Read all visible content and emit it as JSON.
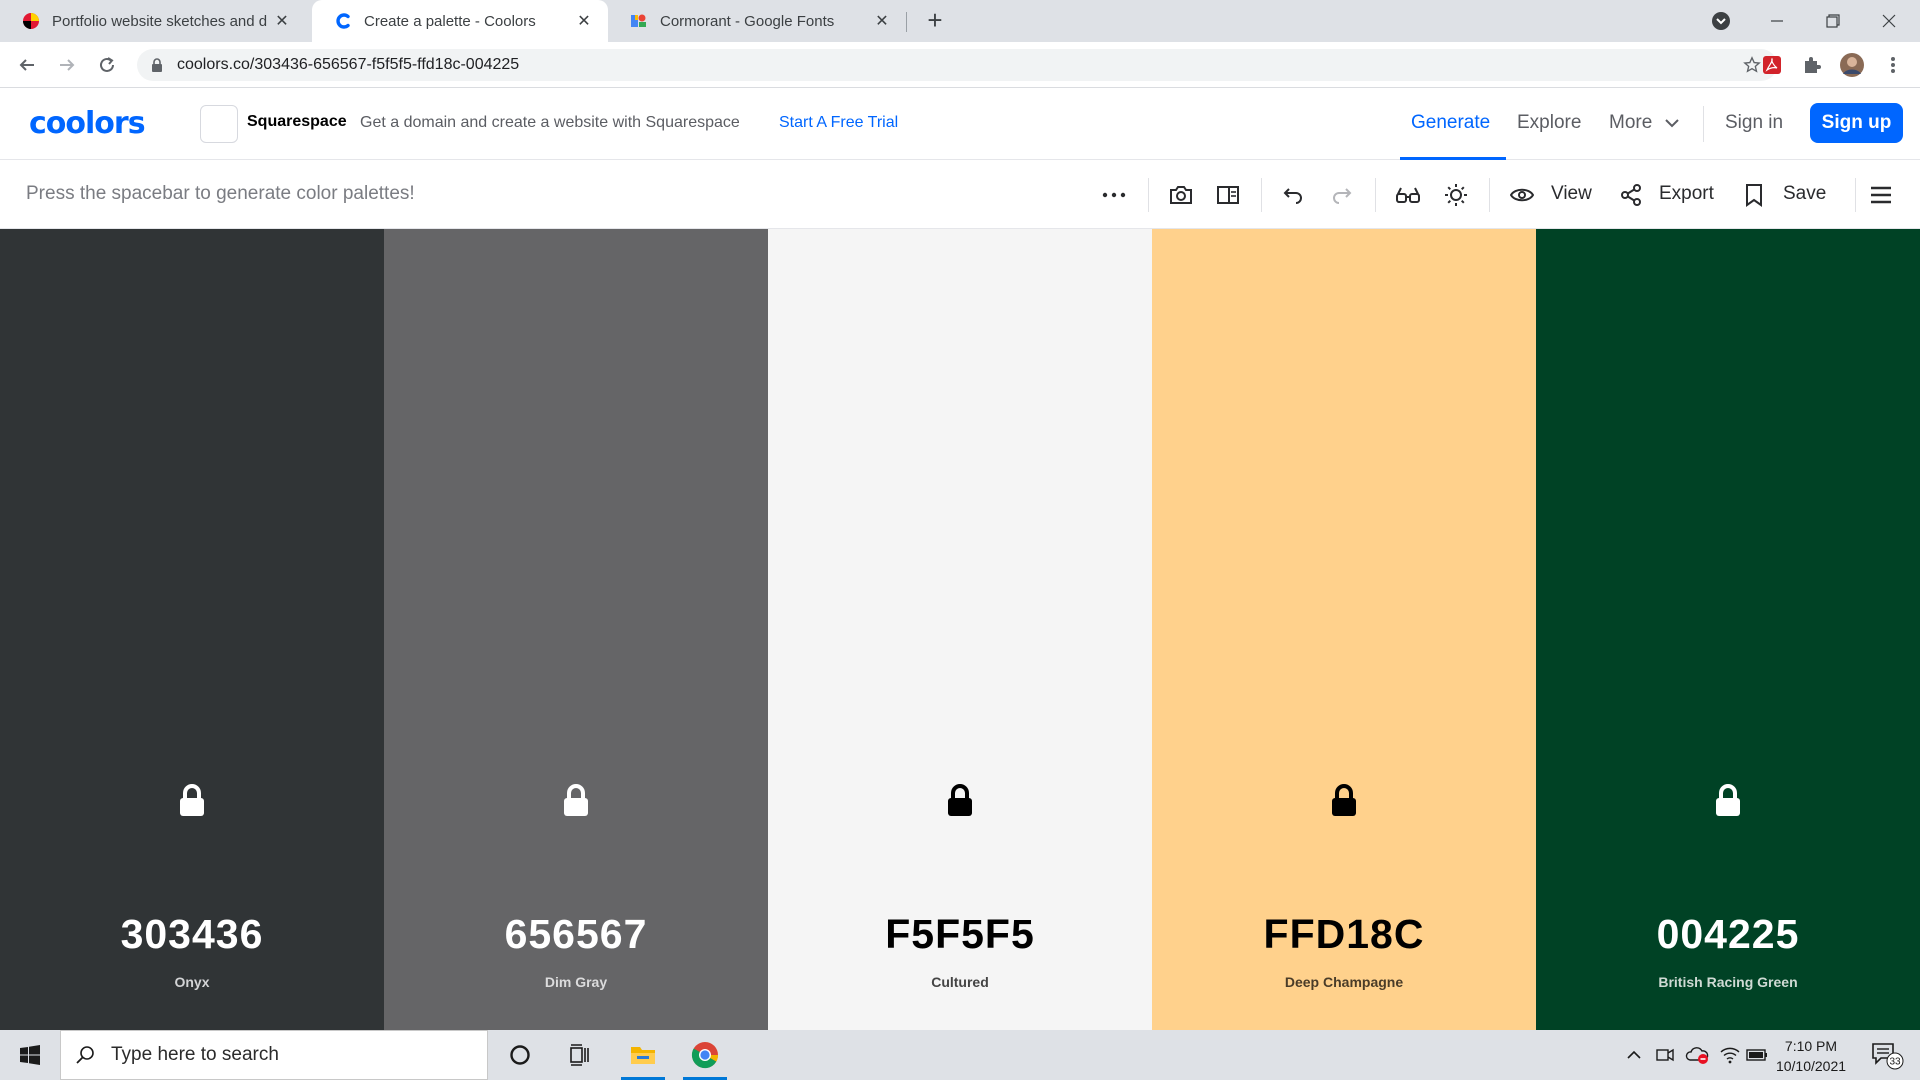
{
  "browser": {
    "tabs": [
      {
        "title": "Portfolio website sketches and d",
        "active": false,
        "favicon": "maryland-flag-icon"
      },
      {
        "title": "Create a palette - Coolors",
        "active": true,
        "favicon": "coolors-icon"
      },
      {
        "title": "Cormorant - Google Fonts",
        "active": false,
        "favicon": "google-fonts-icon"
      }
    ],
    "new_tab": "+",
    "url": "coolors.co/303436-656567-f5f5f5-ffd18c-004225"
  },
  "header": {
    "logo": "coolors",
    "ad": {
      "brand": "Squarespace",
      "text": "Get a domain and create a website with Squarespace",
      "cta": "Start A Free Trial"
    },
    "nav": {
      "generate": "Generate",
      "explore": "Explore",
      "more": "More",
      "signin": "Sign in",
      "signup": "Sign up"
    },
    "accent": "#0066ff"
  },
  "toolbar": {
    "hint": "Press the spacebar to generate color palettes!",
    "view": "View",
    "export": "Export",
    "save": "Save"
  },
  "palette": [
    {
      "hex": "303436",
      "name": "Onyx",
      "color": "#303436",
      "text_color": "#ffffff",
      "name_color": "#d3d4d6",
      "lock_color": "#ffffff"
    },
    {
      "hex": "656567",
      "name": "Dim Gray",
      "color": "#656567",
      "text_color": "#ffffff",
      "name_color": "#dcdcdd",
      "lock_color": "#ffffff"
    },
    {
      "hex": "F5F5F5",
      "name": "Cultured",
      "color": "#f5f5f5",
      "text_color": "#000000",
      "name_color": "#444444",
      "lock_color": "#000000"
    },
    {
      "hex": "FFD18C",
      "name": "Deep Champagne",
      "color": "#ffd18c",
      "text_color": "#000000",
      "name_color": "#4a3c28",
      "lock_color": "#000000"
    },
    {
      "hex": "004225",
      "name": "British Racing Green",
      "color": "#004225",
      "text_color": "#ffffff",
      "name_color": "#cfdad4",
      "lock_color": "#ffffff"
    }
  ],
  "taskbar": {
    "search_placeholder": "Type here to search",
    "time": "7:10 PM",
    "date": "10/10/2021",
    "notifications": "33"
  }
}
